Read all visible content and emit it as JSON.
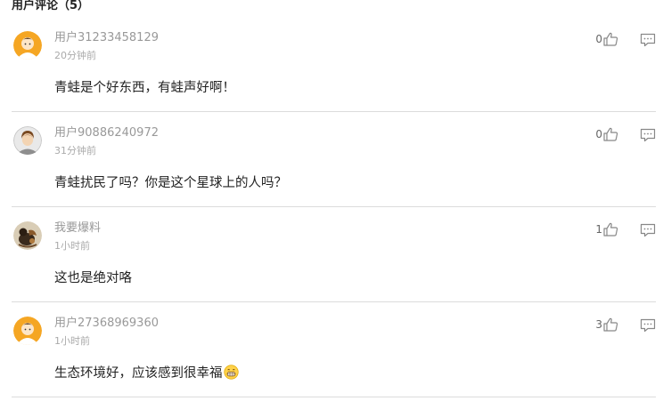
{
  "header": {
    "title": "用户评论（5）"
  },
  "comments": [
    {
      "username": "用户31233458129",
      "time": "20分钟前",
      "text": "青蛙是个好东西，有蛙声好啊！",
      "likes": "0",
      "avatar": "default-orange-avatar"
    },
    {
      "username": "用户90886240972",
      "time": "31分钟前",
      "text": "青蛙扰民了吗？你是这个星球上的人吗？",
      "likes": "0",
      "avatar": "gray-person-avatar"
    },
    {
      "username": "我要爆料",
      "time": "1小时前",
      "text": "这也是绝对咯",
      "likes": "1",
      "avatar": "photo-avatar"
    },
    {
      "username": "用户27368969360",
      "time": "1小时前",
      "text": "生态环境好，应该感到很幸福",
      "likes": "3",
      "avatar": "default-orange-avatar",
      "emoji": "grin-emoji"
    }
  ],
  "colors": {
    "username": "#999999",
    "divider": "#dcdcdc",
    "avatar_orange": "#f5a623"
  }
}
